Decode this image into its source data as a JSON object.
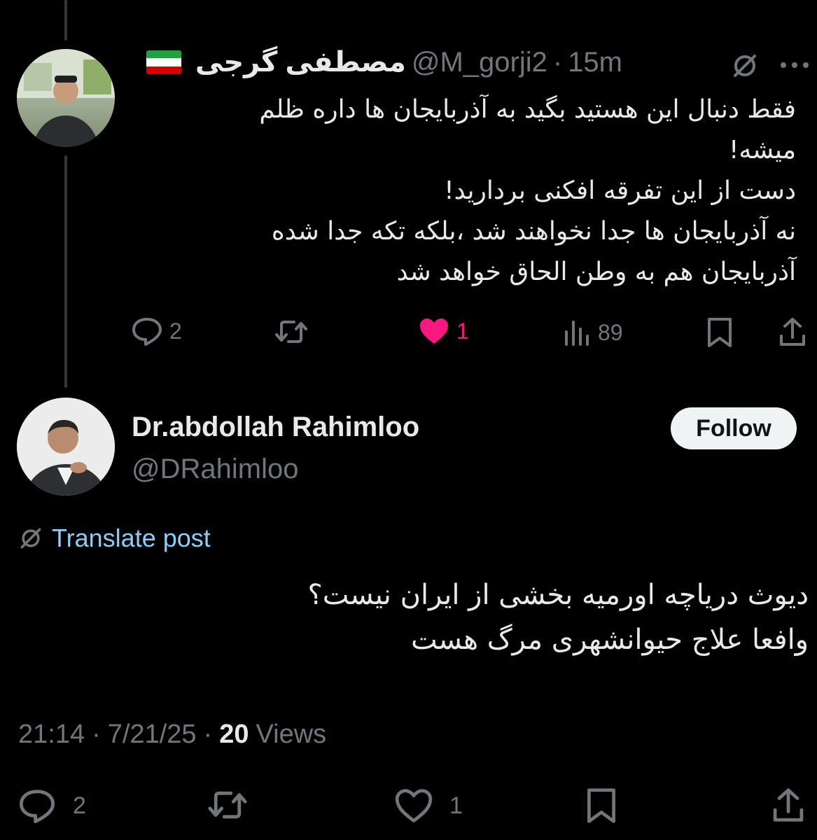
{
  "top_tweet": {
    "display_name": "مصطفی گرجی",
    "handle": "@M_gorji2",
    "time": "15m",
    "text": "فقط دنبال این هستید بگید به آذربایجان ها داره ظلم\nمیشه!\nدست از این تفرقه افکنی بردارید!\nنه آذربایجان ها جدا نخواهند شد ،بلکه تکه جدا شده\nآذربایجان هم به وطن الحاق خواهد شد",
    "replies": "2",
    "likes": "1",
    "views": "89",
    "flag_colors": [
      "#239f40",
      "#ffffff",
      "#da0000"
    ]
  },
  "main_tweet": {
    "display_name": "Dr.abdollah Rahimloo",
    "handle": "@DRahimloo",
    "follow_label": "Follow",
    "translate_label": "Translate post",
    "text": "دیوث دریاچه اورمیه بخشی از ایران نیست؟\nوافعا علاج حیوانشهری مرگ هست",
    "time": "21:14",
    "date": "7/21/25",
    "views_count": "20",
    "views_label": "Views",
    "replies": "2",
    "likes": "1"
  },
  "colors": {
    "background": "#000000",
    "text": "#e7e9ea",
    "muted": "#71767b",
    "link": "#8ecdf8",
    "like_pink": "#f91880"
  },
  "icons": [
    "grok-icon",
    "more-icon",
    "reply-icon",
    "retweet-icon",
    "heart-icon",
    "views-icon",
    "bookmark-icon",
    "share-icon",
    "translate-icon"
  ]
}
